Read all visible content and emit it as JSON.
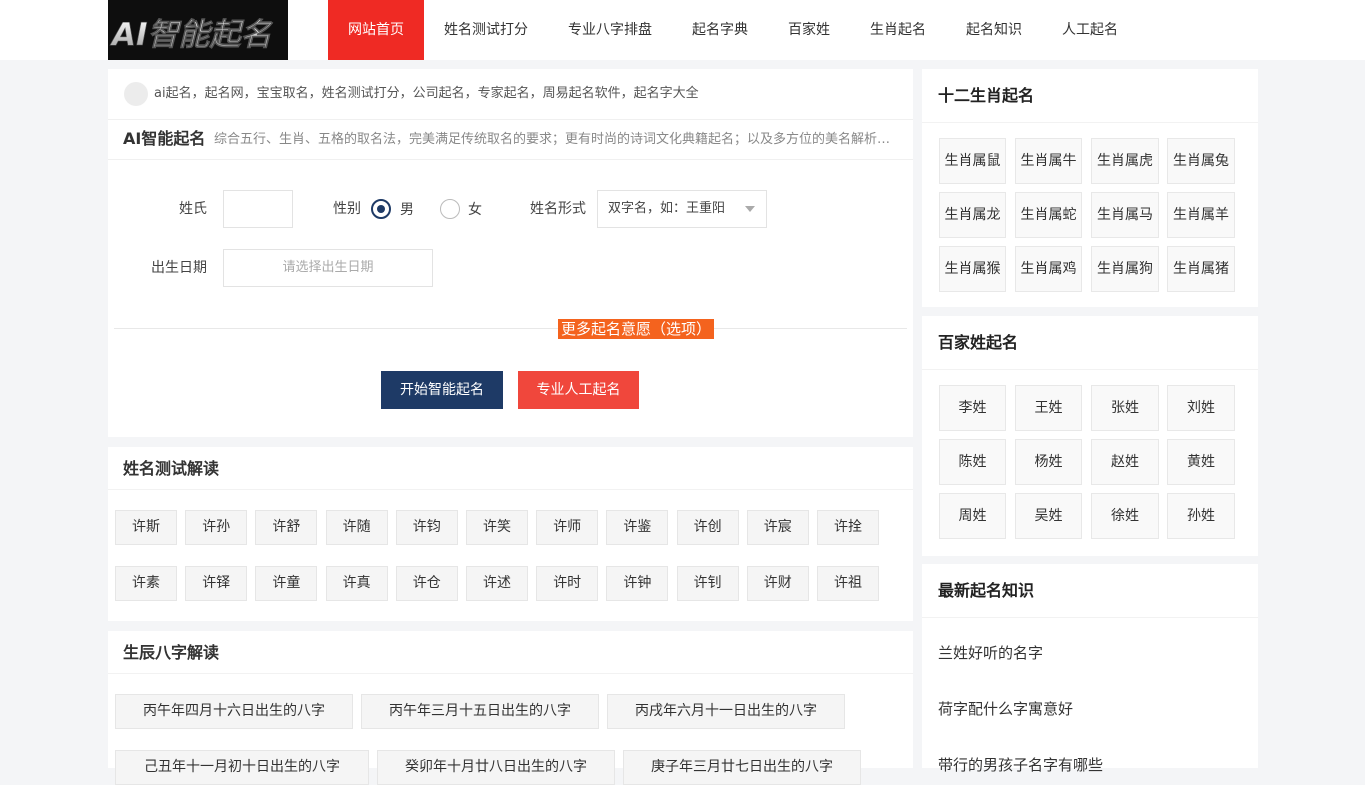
{
  "logo": {
    "text": "AI智能起名"
  },
  "nav": [
    {
      "label": "网站首页",
      "active": true
    },
    {
      "label": "姓名测试打分"
    },
    {
      "label": "专业八字排盘"
    },
    {
      "label": "起名字典"
    },
    {
      "label": "百家姓"
    },
    {
      "label": "生肖起名"
    },
    {
      "label": "起名知识"
    },
    {
      "label": "人工起名"
    }
  ],
  "breadcrumb": {
    "text": "ai起名，起名网，宝宝取名，姓名测试打分，公司起名，专家起名，周易起名软件，起名字大全"
  },
  "form": {
    "title": "AI智能起名",
    "desc": "综合五行、生肖、五格的取名法，完美满足传统取名的要求；更有时尚的诗词文化典籍起名；以及多方位的美名解析，让您轻松起个好名字。",
    "surname_label": "姓氏",
    "surname_value": "",
    "gender_label": "性别",
    "gender_male": "男",
    "gender_female": "女",
    "gender_selected": "男",
    "name_type_label": "姓名形式",
    "name_type_value": "双字名，如：王重阳",
    "birth_label": "出生日期",
    "birth_placeholder": "请选择出生日期",
    "more_label": "更多起名意愿（选项）",
    "btn_ai": "开始智能起名",
    "btn_manual": "专业人工起名"
  },
  "name_test": {
    "title": "姓名测试解读",
    "items": [
      "许斯",
      "许孙",
      "许舒",
      "许随",
      "许钧",
      "许笑",
      "许师",
      "许鉴",
      "许创",
      "许宸",
      "许拴",
      "许素",
      "许铎",
      "许童",
      "许真",
      "许仓",
      "许述",
      "许时",
      "许钟",
      "许钊",
      "许财",
      "许祖"
    ]
  },
  "bazi": {
    "title": "生辰八字解读",
    "items": [
      "丙午年四月十六日出生的八字",
      "丙午年三月十五日出生的八字",
      "丙戌年六月十一日出生的八字",
      "己丑年十一月初十日出生的八字",
      "癸卯年十月廿八日出生的八字",
      "庚子年三月廿七日出生的八字"
    ]
  },
  "zodiac": {
    "title": "十二生肖起名",
    "items": [
      "生肖属鼠",
      "生肖属牛",
      "生肖属虎",
      "生肖属兔",
      "生肖属龙",
      "生肖属蛇",
      "生肖属马",
      "生肖属羊",
      "生肖属猴",
      "生肖属鸡",
      "生肖属狗",
      "生肖属猪"
    ]
  },
  "surnames": {
    "title": "百家姓起名",
    "items": [
      "李姓",
      "王姓",
      "张姓",
      "刘姓",
      "陈姓",
      "杨姓",
      "赵姓",
      "黄姓",
      "周姓",
      "吴姓",
      "徐姓",
      "孙姓"
    ]
  },
  "knowledge": {
    "title": "最新起名知识",
    "items": [
      "兰姓好听的名字",
      "荷字配什么字寓意好",
      "带行的男孩子名字有哪些"
    ]
  },
  "colors": {
    "accent_red": "#ef2a24",
    "navy": "#1e3a66",
    "orange": "#f4631e",
    "button_red": "#f0473c"
  }
}
